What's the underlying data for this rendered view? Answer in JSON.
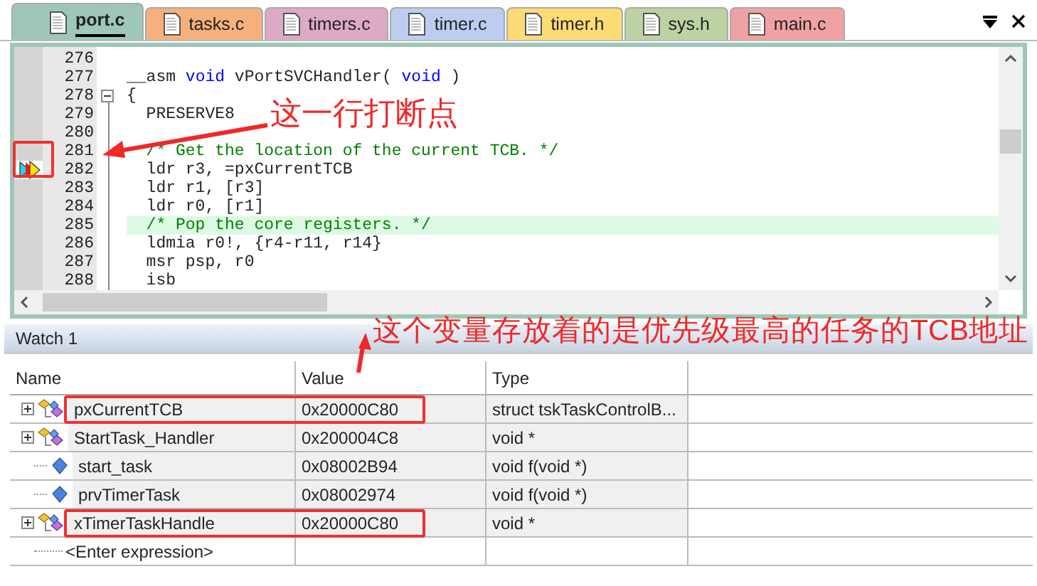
{
  "tabs": [
    {
      "label": "port.c",
      "color": "#9fc7b8",
      "selected": true
    },
    {
      "label": "tasks.c",
      "color": "#f6b07c",
      "selected": false
    },
    {
      "label": "timers.c",
      "color": "#dcaac4",
      "selected": false
    },
    {
      "label": "timer.c",
      "color": "#bccdf0",
      "selected": false
    },
    {
      "label": "timer.h",
      "color": "#fddc76",
      "selected": false
    },
    {
      "label": "sys.h",
      "color": "#bcd2a2",
      "selected": false
    },
    {
      "label": "main.c",
      "color": "#f0a2a2",
      "selected": false
    }
  ],
  "editor": {
    "lines": [
      {
        "number": "276",
        "foldable": false,
        "breakpoint": false,
        "highlighted": false
      },
      {
        "number": "277",
        "foldable": false,
        "breakpoint": false,
        "highlighted": false,
        "segments": [
          {
            "text": "__asm ",
            "kind": "plain"
          },
          {
            "text": "void",
            "kind": "keyword"
          },
          {
            "text": " vPortSVCHandler( ",
            "kind": "plain"
          },
          {
            "text": "void",
            "kind": "keyword"
          },
          {
            "text": " )",
            "kind": "plain"
          }
        ]
      },
      {
        "number": "278",
        "foldable": true,
        "breakpoint": false,
        "highlighted": false,
        "segments": [
          {
            "text": "{",
            "kind": "plain"
          }
        ]
      },
      {
        "number": "279",
        "foldable": false,
        "breakpoint": false,
        "highlighted": false,
        "segments": [
          {
            "text": "  PRESERVE8",
            "kind": "plain"
          }
        ]
      },
      {
        "number": "280",
        "foldable": false,
        "breakpoint": false,
        "highlighted": false
      },
      {
        "number": "281",
        "foldable": false,
        "breakpoint": false,
        "highlighted": false,
        "segments": [
          {
            "text": "  /* Get the location of the current TCB. */",
            "kind": "comment"
          }
        ]
      },
      {
        "number": "282",
        "foldable": false,
        "breakpoint": true,
        "highlighted": false,
        "segments": [
          {
            "text": "  ldr r3, =pxCurrentTCB",
            "kind": "plain"
          }
        ]
      },
      {
        "number": "283",
        "foldable": false,
        "breakpoint": false,
        "highlighted": false,
        "segments": [
          {
            "text": "  ldr r1, [r3]",
            "kind": "plain"
          }
        ]
      },
      {
        "number": "284",
        "foldable": false,
        "breakpoint": false,
        "highlighted": false,
        "segments": [
          {
            "text": "  ldr r0, [r1]",
            "kind": "plain"
          }
        ]
      },
      {
        "number": "285",
        "foldable": false,
        "breakpoint": false,
        "highlighted": true,
        "segments": [
          {
            "text": "  /* Pop the core registers. */",
            "kind": "comment"
          }
        ]
      },
      {
        "number": "286",
        "foldable": false,
        "breakpoint": false,
        "highlighted": false,
        "segments": [
          {
            "text": "  ldmia r0!, {r4-r11, r14}",
            "kind": "plain"
          }
        ]
      },
      {
        "number": "287",
        "foldable": false,
        "breakpoint": false,
        "highlighted": false,
        "segments": [
          {
            "text": "  msr psp, r0",
            "kind": "plain"
          }
        ]
      },
      {
        "number": "288",
        "foldable": false,
        "breakpoint": false,
        "highlighted": false,
        "segments": [
          {
            "text": "  isb",
            "kind": "plain"
          }
        ]
      }
    ]
  },
  "annotations": [
    {
      "text": "这一行打断点"
    },
    {
      "text": "这个变量存放着的是优先级最高的任务的TCB地址"
    }
  ],
  "watch": {
    "title": "Watch 1",
    "columns": [
      "Name",
      "Value",
      "Type"
    ],
    "rows": [
      {
        "name": "pxCurrentTCB",
        "value": "0x20000C80",
        "type": "struct tskTaskControlB...",
        "kind": "variable",
        "expandable": true,
        "outlined": true
      },
      {
        "name": "StartTask_Handler",
        "value": "0x200004C8",
        "type": "void *",
        "kind": "variable",
        "expandable": true,
        "outlined": false
      },
      {
        "name": "start_task",
        "value": "0x08002B94",
        "type": "void f(void *)",
        "kind": "function",
        "expandable": false,
        "outlined": false
      },
      {
        "name": "prvTimerTask",
        "value": "0x08002974",
        "type": "void f(void *)",
        "kind": "function",
        "expandable": false,
        "outlined": false
      },
      {
        "name": "xTimerTaskHandle",
        "value": "0x20000C80",
        "type": "void *",
        "kind": "variable",
        "expandable": true,
        "outlined": true
      }
    ],
    "new_entry": "<Enter expression>"
  }
}
